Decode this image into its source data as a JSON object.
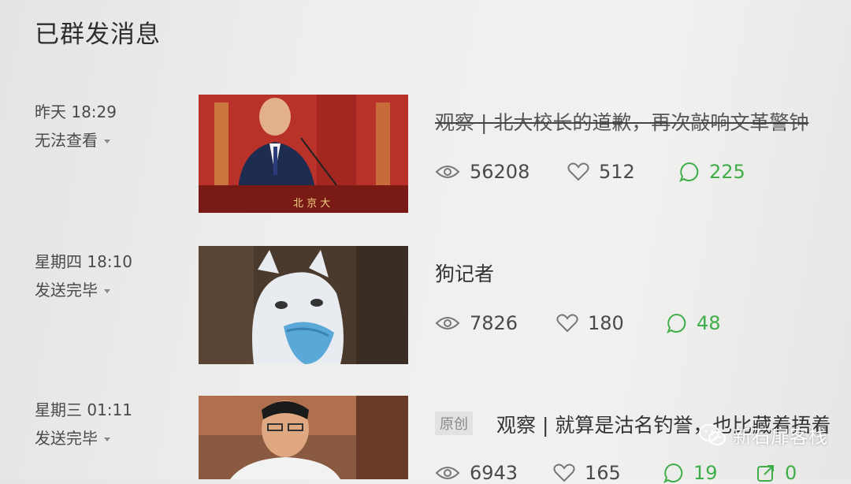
{
  "page": {
    "title": "已群发消息"
  },
  "messages": [
    {
      "time": "昨天 18:29",
      "status": "无法查看",
      "title": "观察 | 北大校长的道歉，再次敲响文革警钟",
      "title_struck": true,
      "views": "56208",
      "likes": "512",
      "comments": "225"
    },
    {
      "time": "星期四 18:10",
      "status": "发送完毕",
      "title": "狗记者",
      "title_struck": false,
      "views": "7826",
      "likes": "180",
      "comments": "48"
    },
    {
      "time": "星期三 01:11",
      "status": "发送完毕",
      "tag": "原创",
      "title": "观察 | 就算是沽名钓誉，也比藏着捂着",
      "title_struck": false,
      "views": "6943",
      "likes": "165",
      "comments": "19",
      "shares": "0"
    }
  ],
  "watermark": {
    "text": "新石扉客栈"
  },
  "colors": {
    "comment_green": "#3fae4a",
    "text": "#333333"
  },
  "icons": [
    "eye-icon",
    "heart-icon",
    "comment-icon",
    "share-icon",
    "wechat-logo-icon",
    "caret-down-icon"
  ]
}
